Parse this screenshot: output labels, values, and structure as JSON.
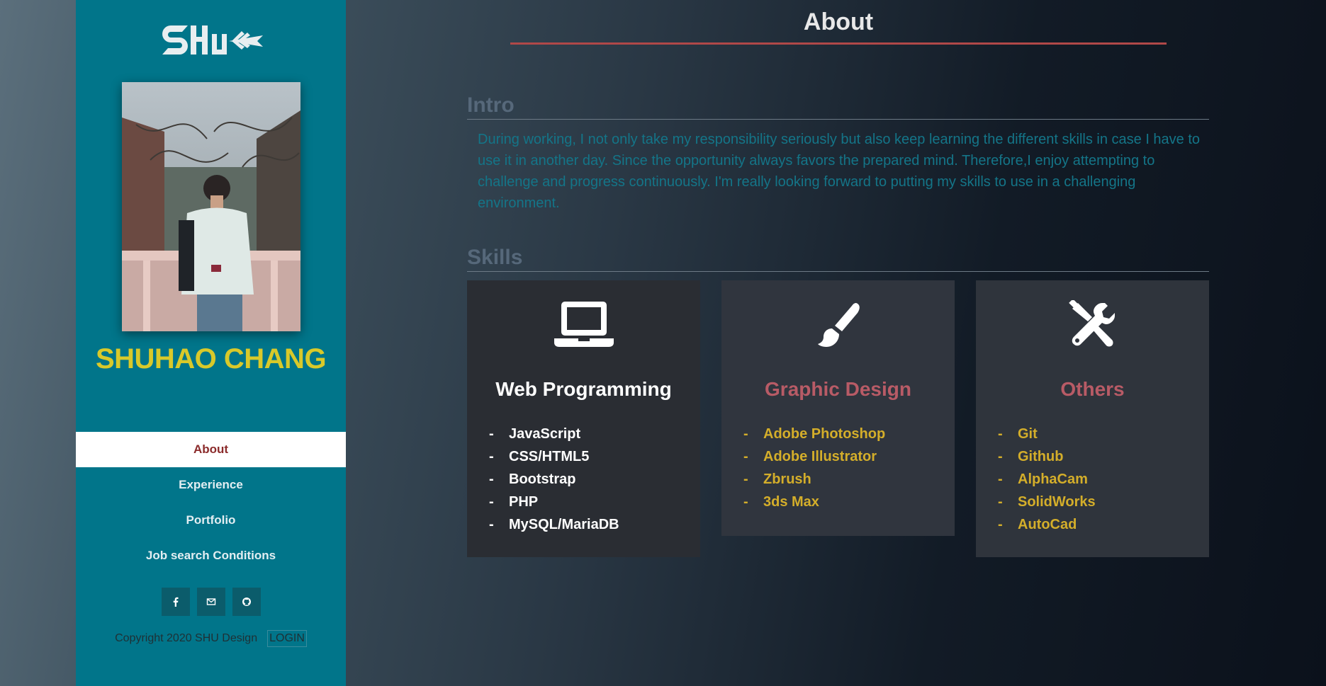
{
  "sidebar": {
    "logo_text": "SHU",
    "owner_name": "SHUHAO CHANG",
    "nav": [
      {
        "label": "About",
        "active": true
      },
      {
        "label": "Experience",
        "active": false
      },
      {
        "label": "Portfolio",
        "active": false
      },
      {
        "label": "Job search Conditions",
        "active": false
      }
    ],
    "social_icons": [
      "facebook-icon",
      "mail-icon",
      "github-icon"
    ],
    "copyright": "Copyright 2020 SHU Design",
    "login_label": "LOGIN"
  },
  "main": {
    "title": "About",
    "intro_heading": "Intro",
    "intro_text": "During working, I not only take my responsibility seriously but also keep learning the different skills in case I have to use it in another day. Since the opportunity always favors the prepared mind. Therefore,I enjoy attempting to challenge and progress continuously. I'm really looking forward to putting my skills to use in a challenging environment.",
    "skills_heading": "Skills",
    "skills": [
      {
        "icon": "laptop-icon",
        "title": "Web Programming",
        "title_color": "#ffffff",
        "item_color": "#ffffff",
        "items": [
          "JavaScript",
          "CSS/HTML5",
          "Bootstrap",
          "PHP",
          "MySQL/MariaDB"
        ]
      },
      {
        "icon": "paintbrush-icon",
        "title": "Graphic Design",
        "title_color": "#b85b66",
        "item_color": "#d4ae2a",
        "items": [
          "Adobe Photoshop",
          "Adobe Illustrator",
          "Zbrush",
          "3ds Max"
        ]
      },
      {
        "icon": "tools-icon",
        "title": "Others",
        "title_color": "#b85b66",
        "item_color": "#d4ae2a",
        "items": [
          "Git",
          "Github",
          "AlphaCam",
          "SolidWorks",
          "AutoCad"
        ]
      }
    ]
  },
  "colors": {
    "sidebar_bg": "#01758a",
    "accent_red": "#b04848",
    "name_yellow": "#d8c92a"
  }
}
